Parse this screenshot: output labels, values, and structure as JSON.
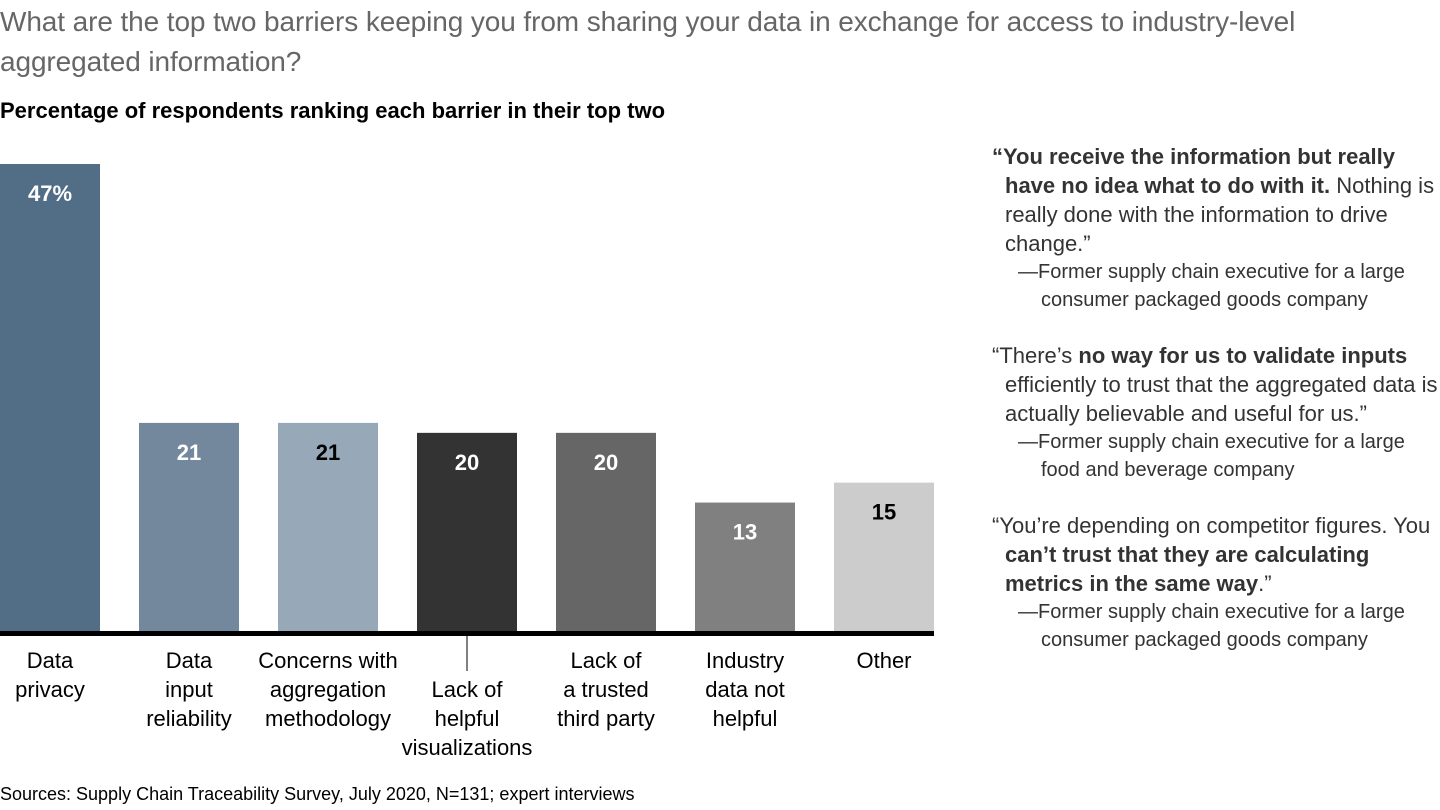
{
  "header": {
    "title": "What are the top two barriers keeping you from sharing your data in exchange for access to industry-level aggregated information?",
    "subtitle": "Percentage of respondents ranking each barrier in their top two"
  },
  "chart_data": {
    "type": "bar",
    "title": "Percentage of respondents ranking each barrier in their top two",
    "xlabel": "",
    "ylabel": "",
    "ylim": [
      0,
      47
    ],
    "grid": false,
    "categories": [
      [
        "Data",
        "privacy"
      ],
      [
        "Data",
        "input",
        "reliability"
      ],
      [
        "Concerns with",
        "aggregation",
        "methodology"
      ],
      [
        "Lack of",
        "helpful",
        "visualizations"
      ],
      [
        "Lack of",
        "a trusted",
        "third party"
      ],
      [
        "Industry",
        "data not",
        "helpful"
      ],
      [
        "Other"
      ]
    ],
    "values": [
      47,
      21,
      21,
      20,
      20,
      13,
      15
    ],
    "value_labels": [
      "47%",
      "21",
      "21",
      "20",
      "20",
      "13",
      "15"
    ],
    "bar_colors": [
      "#526d86",
      "#73889c",
      "#97a9b8",
      "#333333",
      "#666666",
      "#808080",
      "#cccccc"
    ],
    "label_colors": [
      "#ffffff",
      "#ffffff",
      "#000000",
      "#ffffff",
      "#ffffff",
      "#ffffff",
      "#000000"
    ]
  },
  "quotes": [
    {
      "parts": [
        {
          "text": "“You receive the information but really have no idea what to do with it.",
          "bold": true
        },
        {
          "text": " Nothing is really done with the information to drive change.”",
          "bold": false
        }
      ],
      "attribution": "—Former supply chain executive for a large consumer packaged goods company"
    },
    {
      "parts": [
        {
          "text": "“There’s ",
          "bold": false
        },
        {
          "text": "no way for us to validate inputs",
          "bold": true
        },
        {
          "text": " efficiently to trust that the aggregated data is actually believable and useful for us.”",
          "bold": false
        }
      ],
      "attribution": "—Former supply chain executive for a large food and beverage company"
    },
    {
      "parts": [
        {
          "text": "“You’re depending on competitor figures. You ",
          "bold": false
        },
        {
          "text": "can’t trust that they are calculating metrics in the same way",
          "bold": true
        },
        {
          "text": ".”",
          "bold": false
        }
      ],
      "attribution": "—Former supply chain executive for a large consumer packaged goods company"
    }
  ],
  "footer": {
    "source": "Sources: Supply Chain Traceability Survey, July 2020, N=131; expert interviews"
  }
}
